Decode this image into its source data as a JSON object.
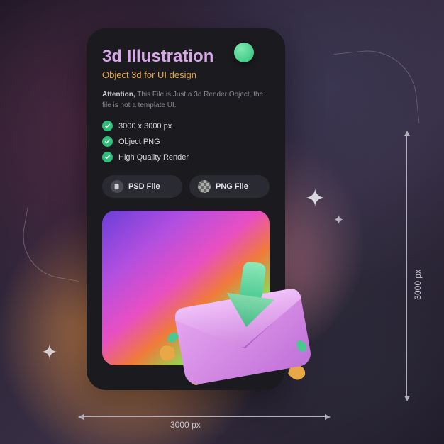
{
  "title": "3d Illustration",
  "subtitle": "Object 3d for UI design",
  "attention_label": "Attention,",
  "attention_text": " This File is Just a 3d Render Object, the file is not a template UI.",
  "features": [
    "3000 x 3000 px",
    "Object PNG",
    "High Quality Render"
  ],
  "file_buttons": {
    "psd": "PSD File",
    "png": "PNG File"
  },
  "dimensions": {
    "width_label": "3000 px",
    "height_label": "3000 px"
  },
  "illustration": "envelope-download-3d"
}
